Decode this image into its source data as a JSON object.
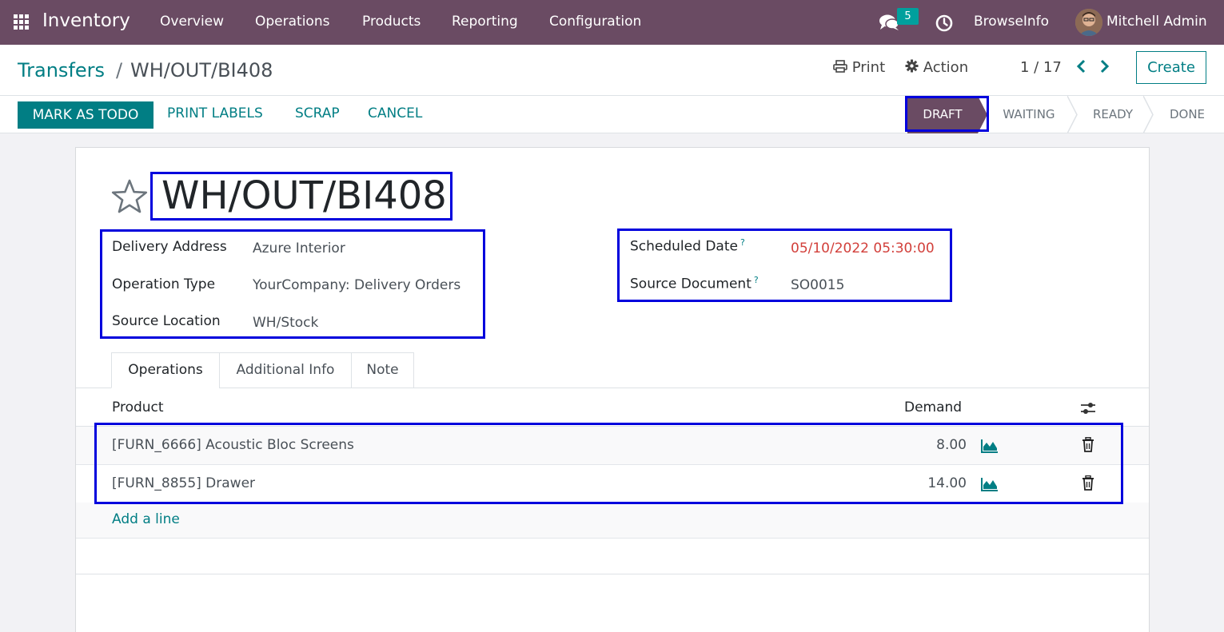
{
  "navbar": {
    "app_name": "Inventory",
    "menu": [
      "Overview",
      "Operations",
      "Products",
      "Reporting",
      "Configuration"
    ],
    "chat_count": "5",
    "company": "BrowseInfo",
    "user": "Mitchell Admin",
    "icons": [
      "apps-grid-icon",
      "chat-icon",
      "clock-icon"
    ]
  },
  "control_panel": {
    "breadcrumb_parent": "Transfers",
    "breadcrumb_separator": "/",
    "breadcrumb_current": "WH/OUT/BI408",
    "print_label": "Print",
    "action_label": "Action",
    "pager_value": "1 / 17",
    "create_label": "Create"
  },
  "statusbar": {
    "buttons": [
      "MARK AS TODO",
      "PRINT LABELS",
      "SCRAP",
      "CANCEL"
    ],
    "stages": [
      "DRAFT",
      "WAITING",
      "READY",
      "DONE"
    ],
    "active_stage": "DRAFT",
    "active_color": "#6a4b63"
  },
  "record": {
    "title": "WH/OUT/BI408",
    "left_fields": [
      {
        "label": "Delivery Address",
        "value": "Azure Interior"
      },
      {
        "label": "Operation Type",
        "value": "YourCompany: Delivery Orders"
      },
      {
        "label": "Source Location",
        "value": "WH/Stock"
      }
    ],
    "right_fields": [
      {
        "label": "Scheduled Date",
        "help": "?",
        "value": "05/10/2022 05:30:00",
        "value_color": "#d23f3a"
      },
      {
        "label": "Source Document",
        "help": "?",
        "value": "SO0015"
      }
    ]
  },
  "tabs": [
    "Operations",
    "Additional Info",
    "Note"
  ],
  "table": {
    "columns": [
      "Product",
      "Demand"
    ],
    "rows": [
      {
        "product": "[FURN_6666] Acoustic Bloc Screens",
        "demand": "8.00"
      },
      {
        "product": "[FURN_8855] Drawer",
        "demand": "14.00"
      }
    ],
    "add_line_label": "Add a line"
  },
  "accent_color": "#017e84",
  "highlight_color": "#0000dd"
}
